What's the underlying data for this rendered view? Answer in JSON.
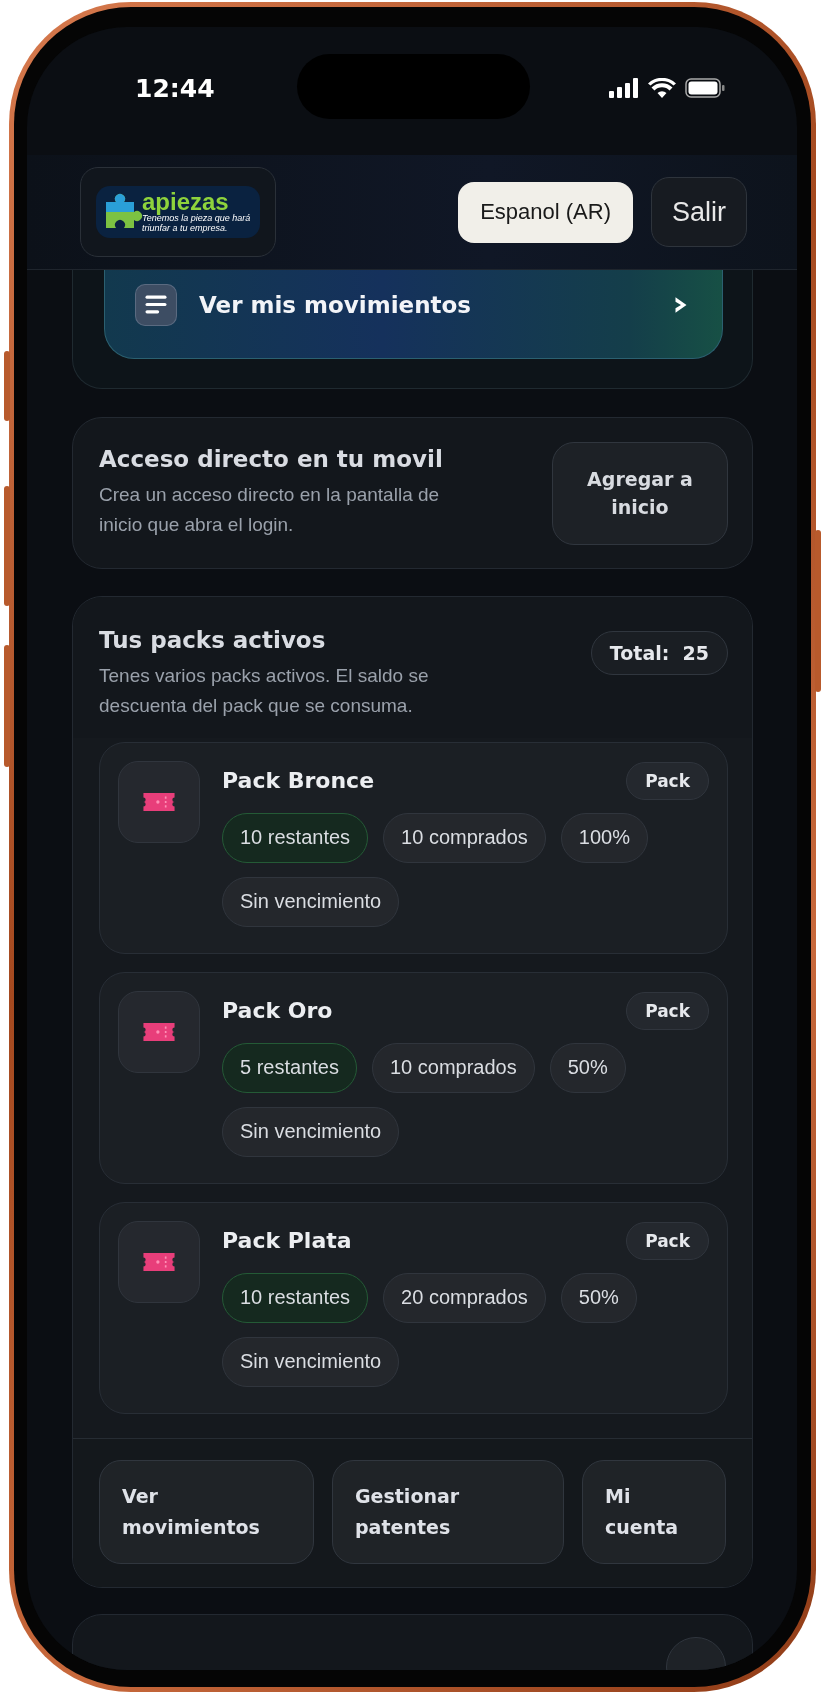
{
  "status_bar": {
    "time": "12:44"
  },
  "header": {
    "logo": {
      "name": "apiezas",
      "tagline": "Tenemos la pieza que hará triunfar a tu empresa."
    },
    "language_button": "Espanol (AR)",
    "logout_button": "Salir"
  },
  "movements_banner": {
    "label": "Ver mis movimientos"
  },
  "shortcut_card": {
    "title": "Acceso directo en tu movil",
    "description": "Crea un acceso directo en la pantalla de inicio que abra el login.",
    "button": "Agregar a inicio"
  },
  "packs": {
    "title": "Tus packs activos",
    "description": "Tenes varios packs activos. El saldo se descuenta del pack que se consuma.",
    "total": "Total:  25",
    "items": [
      {
        "name": "Pack Bronce",
        "badge": "Pack",
        "chips": [
          {
            "text": "10 restantes",
            "kind": "success"
          },
          {
            "text": "10 comprados",
            "kind": "neutral"
          },
          {
            "text": "100%",
            "kind": "neutral"
          },
          {
            "text": "Sin vencimiento",
            "kind": "neutral"
          }
        ]
      },
      {
        "name": "Pack Oro",
        "badge": "Pack",
        "chips": [
          {
            "text": "5 restantes",
            "kind": "success"
          },
          {
            "text": "10 comprados",
            "kind": "neutral"
          },
          {
            "text": "50%",
            "kind": "neutral"
          },
          {
            "text": "Sin vencimiento",
            "kind": "neutral"
          }
        ]
      },
      {
        "name": "Pack Plata",
        "badge": "Pack",
        "chips": [
          {
            "text": "10 restantes",
            "kind": "success"
          },
          {
            "text": "20 comprados",
            "kind": "neutral"
          },
          {
            "text": "50%",
            "kind": "neutral"
          },
          {
            "text": "Sin vencimiento",
            "kind": "neutral"
          }
        ]
      }
    ],
    "actions": [
      "Ver movimientos",
      "Gestionar patentes",
      "Mi cuenta"
    ]
  }
}
